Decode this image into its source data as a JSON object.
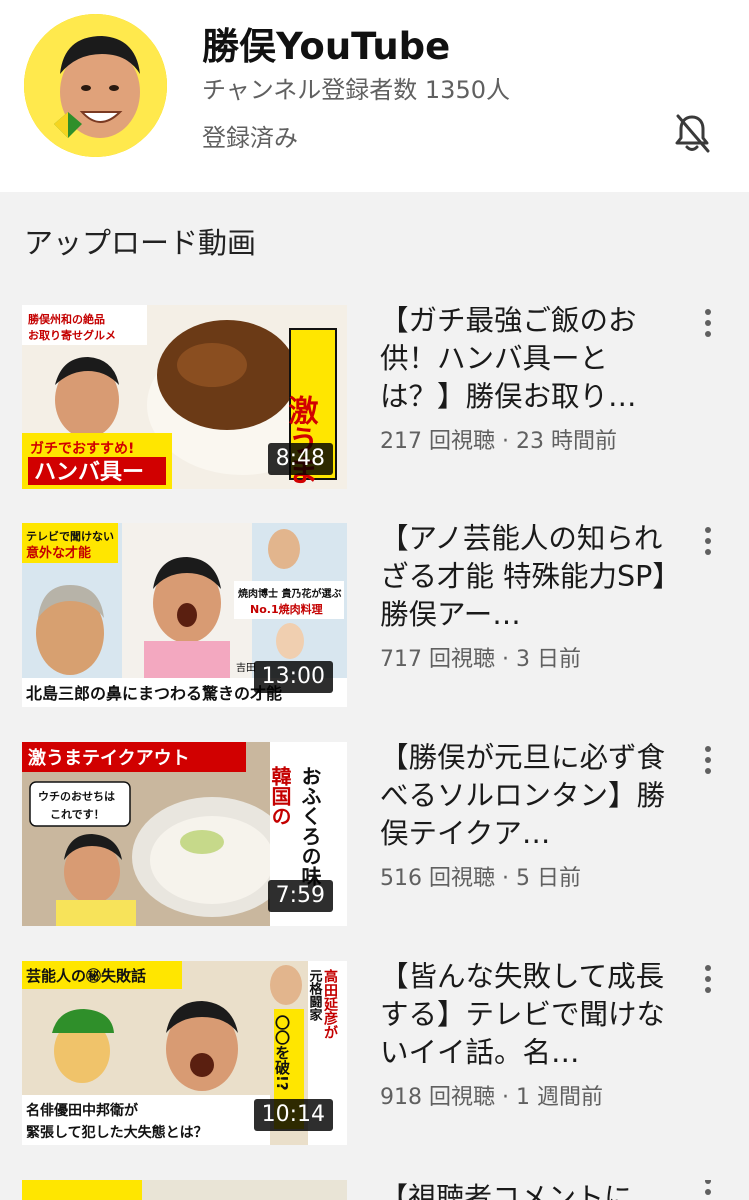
{
  "channel": {
    "name": "勝俣YouTube",
    "subscribers": "チャンネル登録者数 1350人",
    "subscribed": "登録済み"
  },
  "section": {
    "title": "アップロード動画"
  },
  "videos": [
    {
      "title": "【ガチ最強ご飯のお供！ハンバ具ーとは？】勝俣お取り…",
      "meta": "217 回視聴 · 23 時間前",
      "duration": "8:48",
      "thumb": {
        "t1": "勝俣州和の絶品",
        "t2": "お取り寄せグルメ",
        "t3": "ガチでおすすめ!",
        "t4": "ハンバ具ー",
        "t5": "激うま"
      }
    },
    {
      "title": "【アノ芸能人の知られざる才能 特殊能力SP】勝俣アー…",
      "meta": "717 回視聴 · 3 日前",
      "duration": "13:00",
      "thumb": {
        "t1": "テレビで聞けない",
        "t2": "意外な才能",
        "t3": "焼肉博士 貴乃花が選ぶ",
        "t4": "No.1焼肉料理",
        "t5": "北島三郎の鼻にまつわる驚きの才能",
        "t6": "吉田"
      }
    },
    {
      "title": "【勝俣が元旦に必ず食べるソルロンタン】勝俣テイクア…",
      "meta": "516 回視聴 · 5 日前",
      "duration": "7:59",
      "thumb": {
        "t1": "激うまテイクアウト",
        "t2": "ウチのおせちは",
        "t3": "これです！",
        "t4": "韓国の",
        "t5": "おふくろの味"
      }
    },
    {
      "title": "【皆んな失敗して成長する】テレビで聞けないイイ話。名…",
      "meta": "918 回視聴 · 1 週間前",
      "duration": "10:14",
      "thumb": {
        "t1": "芸能人の㊙失敗話",
        "t2": "名俳優田中邦衛が",
        "t3": "緊張して犯した大失態とは？",
        "t4": "元格闘家",
        "t5": "高田延彦が",
        "t6": "〇〇を破!?"
      }
    }
  ],
  "partial_video": {
    "title": "【視聴者コメントに"
  }
}
